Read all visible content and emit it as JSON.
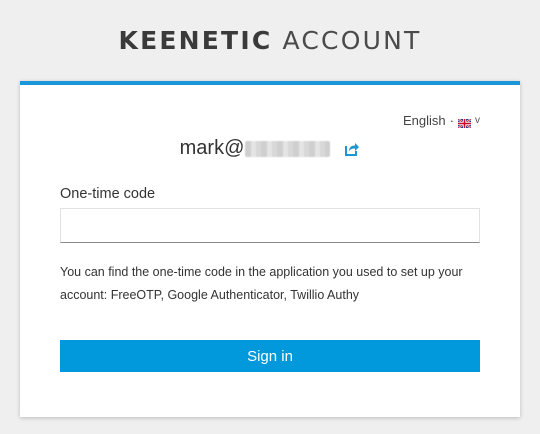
{
  "brand": {
    "name_bold": "KEENETIC",
    "name_light": "ACCOUNT"
  },
  "language": {
    "label": "English",
    "separator": "·",
    "flag_icon": "uk-flag-icon",
    "chevron_icon": "chevron-down-icon",
    "chevron_char": "v"
  },
  "account": {
    "email_prefix": "mark@",
    "share_icon": "share-icon"
  },
  "form": {
    "otp_label": "One-time code",
    "otp_value": "",
    "hint": "You can find the one-time code in the application you used to set up your account: FreeOTP, Google Authenticator, Twillio Authy",
    "submit_label": "Sign in"
  },
  "colors": {
    "accent": "#1a97d8",
    "button": "#0198dc",
    "background": "#efefef"
  }
}
